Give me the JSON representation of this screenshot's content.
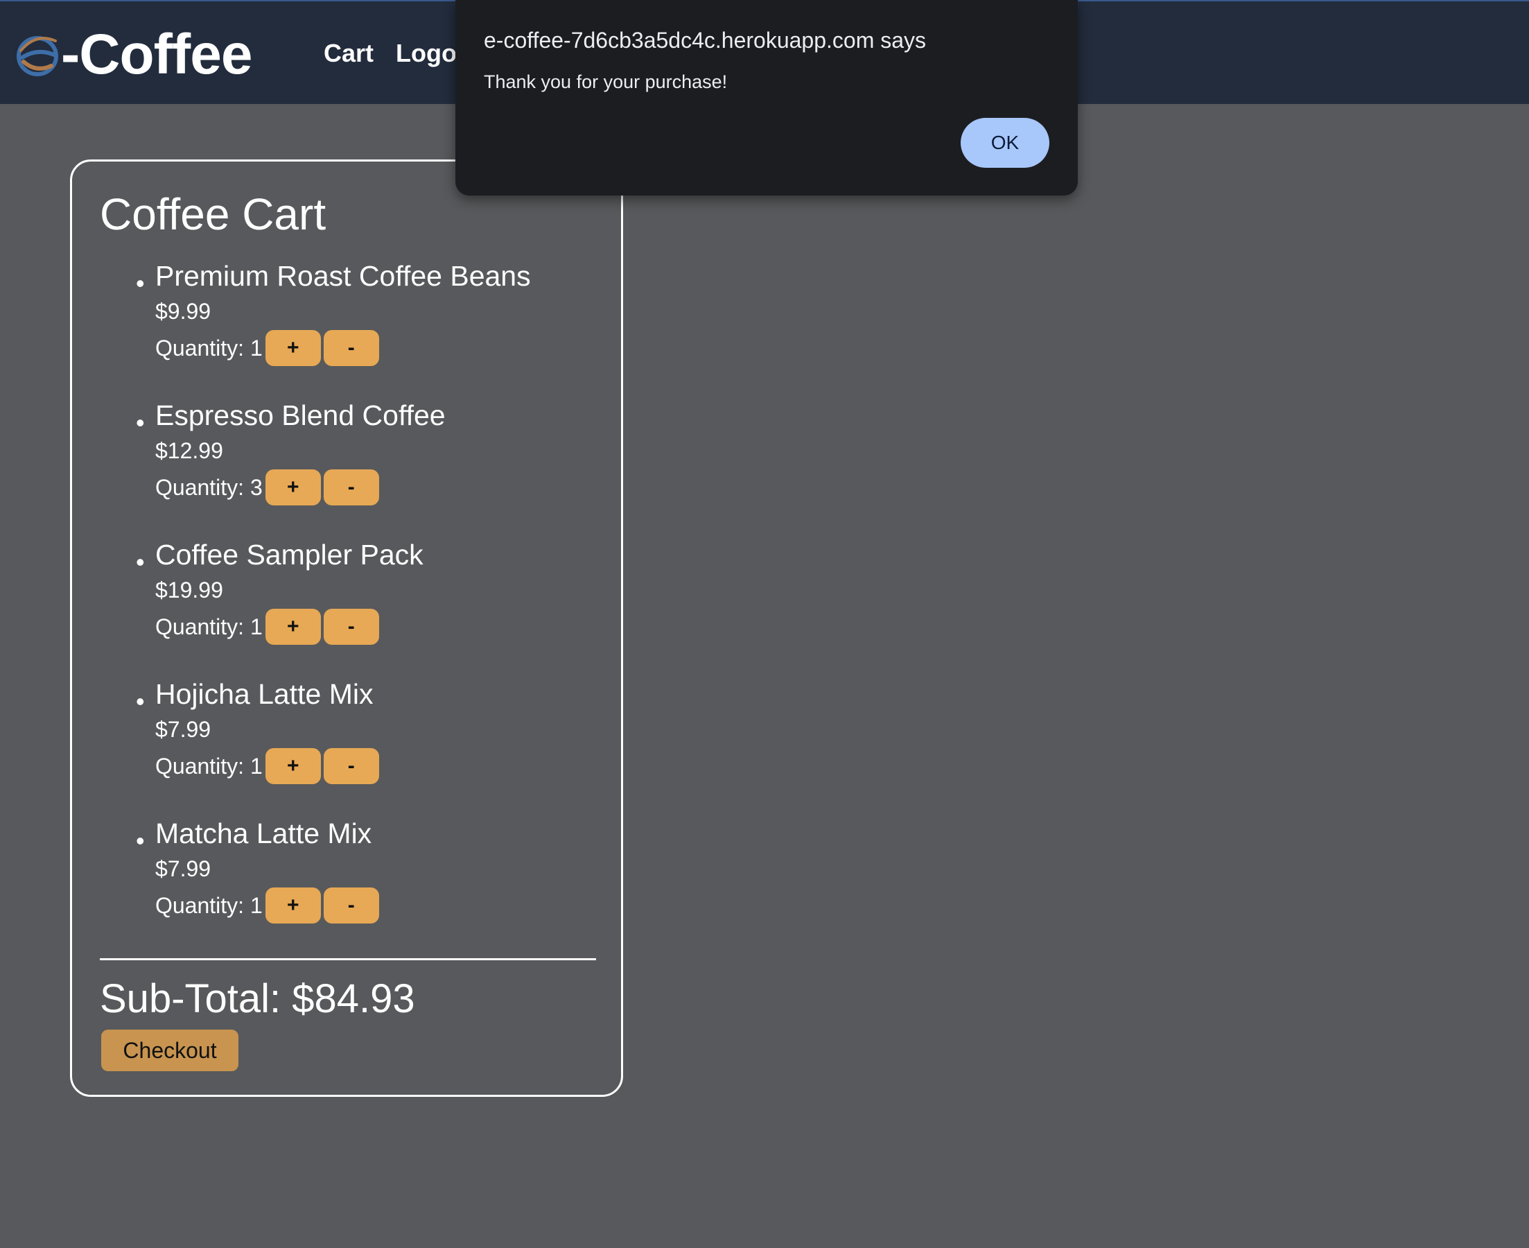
{
  "header": {
    "brand": "-Coffee",
    "nav": [
      {
        "label": "Cart"
      },
      {
        "label": "Logo"
      }
    ]
  },
  "cart": {
    "title": "Coffee Cart",
    "items": [
      {
        "name": "Premium Roast Coffee Beans",
        "price": "$9.99",
        "quantity_text": "Quantity: 1",
        "quantity": 1
      },
      {
        "name": "Espresso Blend Coffee",
        "price": "$12.99",
        "quantity_text": "Quantity: 3",
        "quantity": 3
      },
      {
        "name": "Coffee Sampler Pack",
        "price": "$19.99",
        "quantity_text": "Quantity: 1",
        "quantity": 1
      },
      {
        "name": "Hojicha Latte Mix",
        "price": "$7.99",
        "quantity_text": "Quantity: 1",
        "quantity": 1
      },
      {
        "name": "Matcha Latte Mix",
        "price": "$7.99",
        "quantity_text": "Quantity: 1",
        "quantity": 1
      }
    ],
    "increment_label": "+",
    "decrement_label": "-",
    "subtotal": "Sub-Total: $84.93",
    "checkout_label": "Checkout"
  },
  "dialog": {
    "title": "e-coffee-7d6cb3a5dc4c.herokuapp.com says",
    "message": "Thank you for your purchase!",
    "ok_label": "OK"
  },
  "colors": {
    "page_background": "#58595c",
    "header_background": "#222c3d",
    "quantity_button": "#e7a955",
    "checkout_button": "#c8944f",
    "dialog_background": "#1c1d21",
    "dialog_ok_button": "#a8c7fa"
  },
  "icons": {
    "logo": "e-coffee-logo-icon"
  }
}
